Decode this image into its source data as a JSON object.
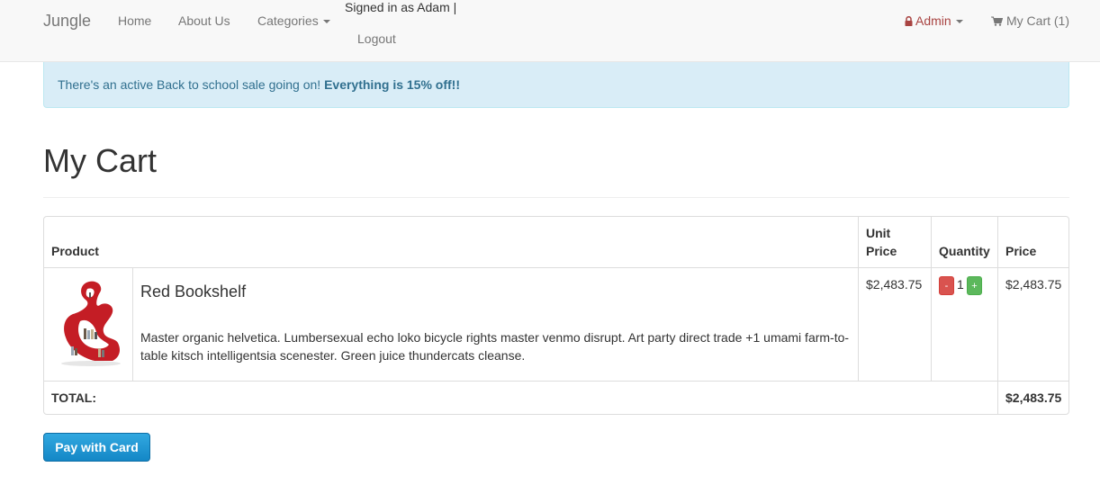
{
  "navbar": {
    "brand": "Jungle",
    "home": "Home",
    "about": "About Us",
    "categories": "Categories",
    "signed_in": "Signed in as Adam |",
    "logout": "Logout",
    "admin": "Admin",
    "cart": "My Cart (1)"
  },
  "alert": {
    "text": "There's an active Back to school sale going on! ",
    "emphasis": "Everything is 15% off!!"
  },
  "page": {
    "title": "My Cart"
  },
  "table": {
    "headers": {
      "product": "Product",
      "unit_price_1": "Unit",
      "unit_price_2": "Price",
      "quantity": "Quantity",
      "price": "Price"
    },
    "rows": [
      {
        "name": "Red Bookshelf",
        "description": "Master organic helvetica. Lumbersexual echo loko bicycle rights master venmo disrupt. Art party direct trade +1 umami farm-to-table kitsch intelligentsia scenester. Green juice thundercats cleanse.",
        "unit_price": "$2,483.75",
        "quantity": "1",
        "minus": "-",
        "plus": "+",
        "price": "$2,483.75"
      }
    ],
    "total_label": "TOTAL:",
    "total_value": "$2,483.75"
  },
  "pay_button": "Pay with Card",
  "colors": {
    "admin": "#a94442",
    "alert_bg": "#d9edf7",
    "alert_text": "#31708f",
    "minus_button": "#d9534f",
    "plus_button": "#5cb85c",
    "pay_button": "#1f97d4"
  }
}
